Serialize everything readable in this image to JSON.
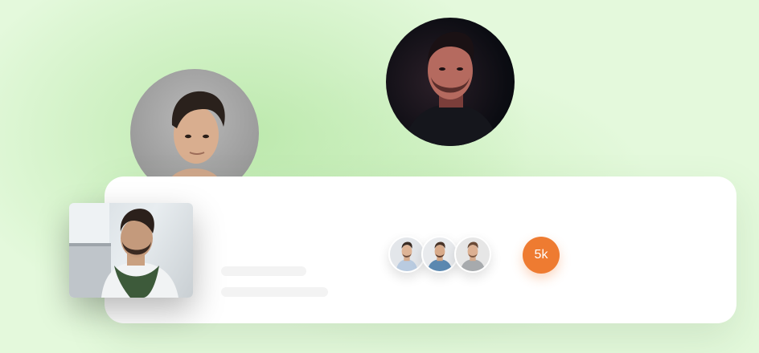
{
  "members": {
    "count_badge": "5k"
  },
  "icons": {
    "avatar_left": "person-avatar-icon",
    "avatar_right": "person-avatar-icon",
    "photo": "person-photo-icon",
    "member_avatar": "person-avatar-icon"
  },
  "colors": {
    "badge": "#ee7b31",
    "card": "#ffffff",
    "background": "#e4f9dc"
  }
}
